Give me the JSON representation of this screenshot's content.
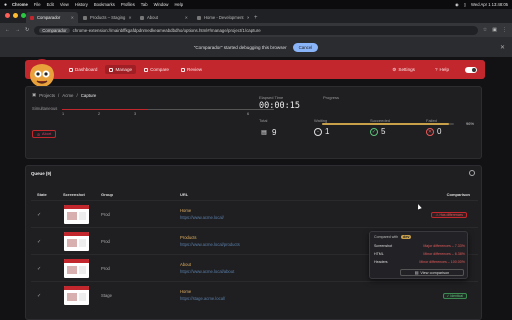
{
  "mac_menu": {
    "app": "Chrome",
    "items": [
      "File",
      "Edit",
      "View",
      "History",
      "Bookmarks",
      "Profiles",
      "Tab",
      "Window",
      "Help"
    ],
    "clock": "Wed Apr 1  13:48:05"
  },
  "tabs": [
    {
      "label": "Comparador",
      "active": true
    },
    {
      "label": "Products – Staging",
      "active": false
    },
    {
      "label": "About",
      "active": false
    },
    {
      "label": "Home - Development",
      "active": false
    }
  ],
  "address": {
    "chip": "Comparador",
    "url": "chrome-extension://mainbffkgafdpdnmedkeameabdbdho/options.html#/manage/project/1/capture"
  },
  "debug_banner": {
    "message": "\"Comparador\" started debugging this browser",
    "cancel": "Cancel"
  },
  "nav": {
    "items": [
      {
        "label": "Dashboard",
        "active": false
      },
      {
        "label": "Manage",
        "active": true
      },
      {
        "label": "Compare",
        "active": false
      },
      {
        "label": "Review",
        "active": false
      }
    ],
    "settings": "Settings",
    "help": "Help"
  },
  "breadcrumb": [
    "Projects",
    "Acme",
    "Capture"
  ],
  "capture": {
    "simultaneous_label": "Simultaneous",
    "ticks": [
      "1",
      "2",
      "3",
      "6"
    ],
    "simultaneous_value": 3,
    "simultaneous_max": 6,
    "abort": "Abort",
    "elapsed_label": "Elapsed Time",
    "elapsed": "00:00:15",
    "progress_label": "Progress",
    "progress_pct": "96%",
    "progress_value": 0.96,
    "stats": [
      {
        "label": "Total",
        "value": "9"
      },
      {
        "label": "Waiting",
        "value": "1"
      },
      {
        "label": "Succeeded",
        "value": "5"
      },
      {
        "label": "Failed",
        "value": "0"
      }
    ]
  },
  "queue": {
    "title": "Queue (9)",
    "columns": [
      "State",
      "Screenshot",
      "Group",
      "URL",
      "Comparison"
    ],
    "rows": [
      {
        "group": "Prod",
        "title": "Home",
        "url": "https://www.acme.local/",
        "comparison": "Has differences",
        "status": "red"
      },
      {
        "group": "Prod",
        "title": "Products",
        "url": "https://www.acme.local/products",
        "comparison": "",
        "status": "none"
      },
      {
        "group": "Prod",
        "title": "About",
        "url": "https://www.acme.local/about",
        "comparison": "Identical",
        "status": "green"
      },
      {
        "group": "Stage",
        "title": "Home",
        "url": "https://stage.acme.local/",
        "comparison": "Identical",
        "status": "green"
      }
    ]
  },
  "popup": {
    "compared_with": "Compared with",
    "pill": "dev",
    "lines": [
      {
        "k": "Screenshot",
        "v": "Major differences – 7.33%"
      },
      {
        "k": "HTML",
        "v": "Minor differences – 6.38%"
      },
      {
        "k": "Headers",
        "v": "Minor differences – 100.00%"
      }
    ],
    "view": "View comparison"
  }
}
